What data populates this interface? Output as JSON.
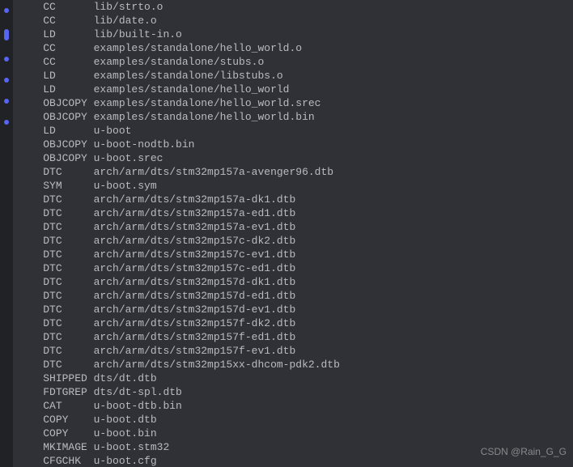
{
  "watermark": "CSDN @Rain_G_G",
  "lines": [
    {
      "cmd": "  CC",
      "file": "lib/strto.o"
    },
    {
      "cmd": "  CC",
      "file": "lib/date.o"
    },
    {
      "cmd": "  LD",
      "file": "lib/built-in.o"
    },
    {
      "cmd": "  CC",
      "file": "examples/standalone/hello_world.o"
    },
    {
      "cmd": "  CC",
      "file": "examples/standalone/stubs.o"
    },
    {
      "cmd": "  LD",
      "file": "examples/standalone/libstubs.o"
    },
    {
      "cmd": "  LD",
      "file": "examples/standalone/hello_world"
    },
    {
      "cmd": "  OBJCOPY",
      "file": "examples/standalone/hello_world.srec"
    },
    {
      "cmd": "  OBJCOPY",
      "file": "examples/standalone/hello_world.bin"
    },
    {
      "cmd": "  LD",
      "file": "u-boot"
    },
    {
      "cmd": "  OBJCOPY",
      "file": "u-boot-nodtb.bin"
    },
    {
      "cmd": "  OBJCOPY",
      "file": "u-boot.srec"
    },
    {
      "cmd": "  DTC",
      "file": "arch/arm/dts/stm32mp157a-avenger96.dtb"
    },
    {
      "cmd": "  SYM",
      "file": "u-boot.sym"
    },
    {
      "cmd": "  DTC",
      "file": "arch/arm/dts/stm32mp157a-dk1.dtb"
    },
    {
      "cmd": "  DTC",
      "file": "arch/arm/dts/stm32mp157a-ed1.dtb"
    },
    {
      "cmd": "  DTC",
      "file": "arch/arm/dts/stm32mp157a-ev1.dtb"
    },
    {
      "cmd": "  DTC",
      "file": "arch/arm/dts/stm32mp157c-dk2.dtb"
    },
    {
      "cmd": "  DTC",
      "file": "arch/arm/dts/stm32mp157c-ev1.dtb"
    },
    {
      "cmd": "  DTC",
      "file": "arch/arm/dts/stm32mp157c-ed1.dtb"
    },
    {
      "cmd": "  DTC",
      "file": "arch/arm/dts/stm32mp157d-dk1.dtb"
    },
    {
      "cmd": "  DTC",
      "file": "arch/arm/dts/stm32mp157d-ed1.dtb"
    },
    {
      "cmd": "  DTC",
      "file": "arch/arm/dts/stm32mp157d-ev1.dtb"
    },
    {
      "cmd": "  DTC",
      "file": "arch/arm/dts/stm32mp157f-dk2.dtb"
    },
    {
      "cmd": "  DTC",
      "file": "arch/arm/dts/stm32mp157f-ed1.dtb"
    },
    {
      "cmd": "  DTC",
      "file": "arch/arm/dts/stm32mp157f-ev1.dtb"
    },
    {
      "cmd": "  DTC",
      "file": "arch/arm/dts/stm32mp15xx-dhcom-pdk2.dtb"
    },
    {
      "cmd": "  SHIPPED",
      "file": "dts/dt.dtb"
    },
    {
      "cmd": "  FDTGREP",
      "file": "dts/dt-spl.dtb"
    },
    {
      "cmd": "  CAT",
      "file": "u-boot-dtb.bin"
    },
    {
      "cmd": "  COPY",
      "file": "u-boot.dtb"
    },
    {
      "cmd": "  COPY",
      "file": "u-boot.bin"
    },
    {
      "cmd": "  MKIMAGE",
      "file": "u-boot.stm32"
    },
    {
      "cmd": "  CFGCHK",
      "file": "u-boot.cfg"
    }
  ]
}
